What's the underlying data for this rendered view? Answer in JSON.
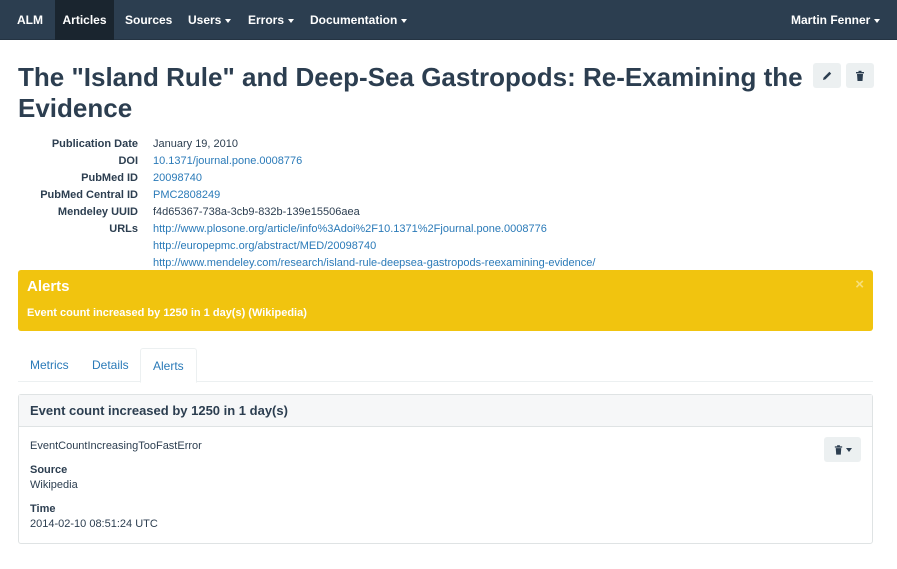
{
  "navbar": {
    "brand": "ALM",
    "items": [
      {
        "label": "Articles",
        "active": true
      },
      {
        "label": "Sources"
      },
      {
        "label": "Users"
      },
      {
        "label": "Errors"
      },
      {
        "label": "Documentation"
      }
    ],
    "user": "Martin Fenner"
  },
  "article": {
    "title": "The \"Island Rule\" and Deep-Sea Gastropods: Re-Examining the Evidence",
    "fields": [
      {
        "label": "Publication Date",
        "value": "January 19, 2010"
      },
      {
        "label": "DOI",
        "value": "10.1371/journal.pone.0008776"
      },
      {
        "label": "PubMed ID",
        "value": "20098740"
      },
      {
        "label": "PubMed Central ID",
        "value": "PMC2808249"
      },
      {
        "label": "Mendeley UUID",
        "value": "f4d65367-738a-3cb9-832b-139e15506aea"
      },
      {
        "label": "URLs",
        "values": [
          "http://www.plosone.org/article/info%3Adoi%2F10.1371%2Fjournal.pone.0008776",
          "http://europepmc.org/abstract/MED/20098740",
          "http://www.mendeley.com/research/island-rule-deepsea-gastropods-reexamining-evidence/"
        ]
      }
    ]
  },
  "alert_box": {
    "title": "Alerts",
    "message": "Event count increased by 1250 in 1 day(s) (Wikipedia)",
    "close": "×"
  },
  "tabs": [
    "Metrics",
    "Details",
    "Alerts"
  ],
  "panel": {
    "title": "Event count increased by 1250 in 1 day(s)",
    "error_class": "EventCountIncreasingTooFastError",
    "source_label": "Source",
    "source_value": "Wikipedia",
    "time_label": "Time",
    "time_value": "2014-02-10 08:51:24 UTC"
  },
  "colors": {
    "navbar": "#2c3e50",
    "alert": "#f1c40f",
    "link": "#2a7ab8"
  }
}
